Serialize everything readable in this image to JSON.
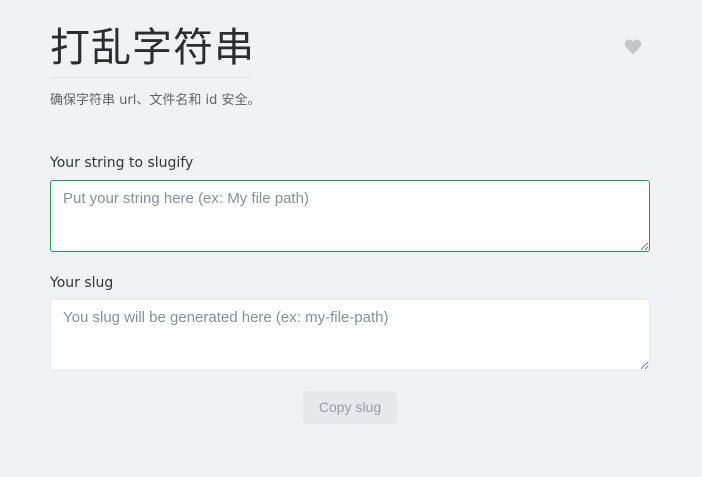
{
  "tool": {
    "title": "打乱字符串",
    "description": "确保字符串 url、文件名和 id 安全。"
  },
  "favorite": {
    "icon": "heart-icon",
    "color": "#c2c5c9"
  },
  "input": {
    "label": "Your string to slugify",
    "placeholder": "Put your string here (ex: My file path)",
    "value": ""
  },
  "output": {
    "label": "Your slug",
    "placeholder": "You slug will be generated here (ex: my-file-path)",
    "value": ""
  },
  "actions": {
    "copy_label": "Copy slug"
  },
  "colors": {
    "accent": "#18a058",
    "background": "#f0f2f5"
  }
}
